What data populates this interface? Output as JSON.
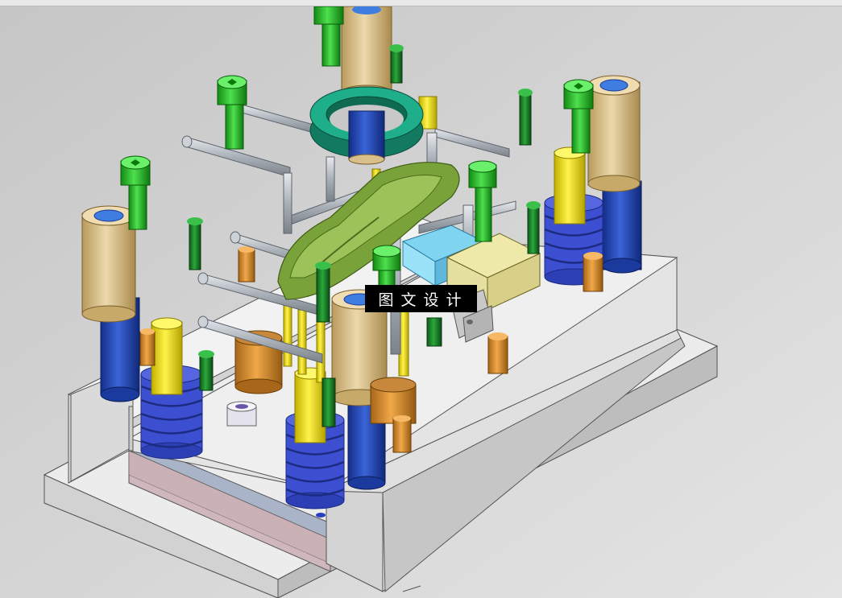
{
  "viewport": {
    "background": "#cfcfcf",
    "overlay_label": "图文设计"
  },
  "colors": {
    "plate": "#e8e8e8",
    "plate_side": "#c9c9c9",
    "gold": "#d8c08a",
    "blue": "#2448b8",
    "spring": "#3c4fd0",
    "yellow": "#f0de17",
    "green": "#1fc21f",
    "dark_green": "#1a8a2a",
    "teal": "#1a9a7a",
    "olive": "#7aa23a",
    "orange": "#d88a2a",
    "steel": "#b8bec6",
    "cyan": "#7fd4ef"
  }
}
